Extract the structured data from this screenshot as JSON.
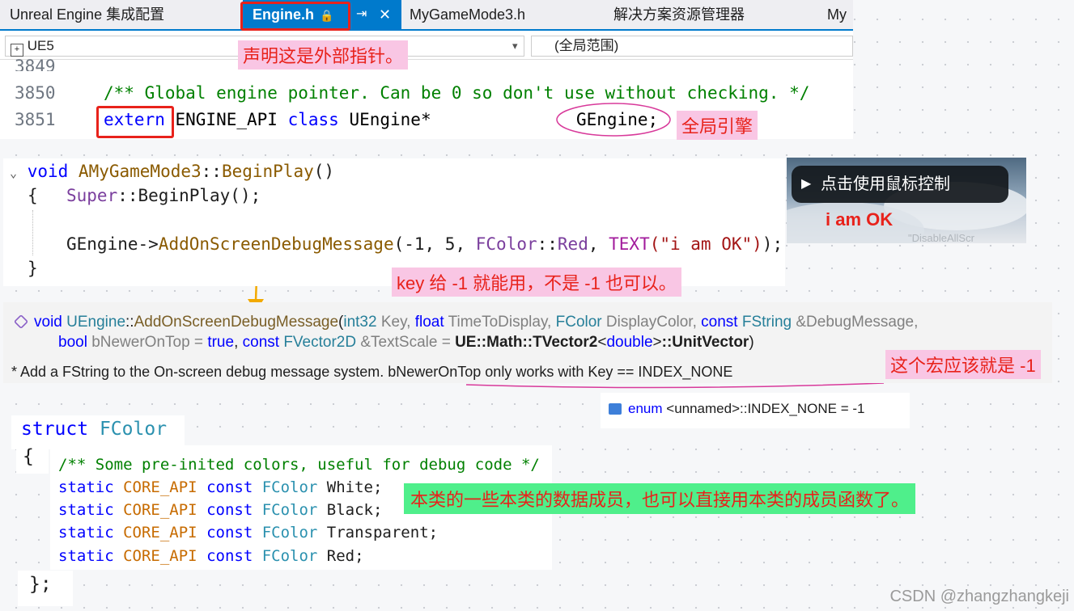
{
  "editor": {
    "tabs": [
      {
        "label": "Unreal Engine 集成配置"
      },
      {
        "label": "Engine.h",
        "lock": "🔒",
        "pin": "⇥",
        "close": "✕"
      },
      {
        "label": "MyGameMode3.h"
      },
      {
        "label": "解决方案资源管理器"
      },
      {
        "label": "My"
      }
    ],
    "nav": {
      "project": "UE5",
      "dropdown_arrow": "▾",
      "scope": "(全局范围)"
    },
    "line_numbers": [
      "3849",
      "3850",
      "3851"
    ],
    "code_comment": "/** Global engine pointer. Can be 0 so don't use without checking. */",
    "code_extern": "extern",
    "code_api": " ENGINE_API ",
    "code_class": "class",
    "code_type": " UEngine*",
    "code_var": "GEngine;"
  },
  "annotations": {
    "extern_note": "声明这是外部指针。",
    "gengine_note": "全局引擎",
    "key_note": "key 给 -1 就能用，不是 -1 也可以。",
    "macro_note": "这个宏应该就是 -1",
    "fcolor_note": "本类的一些本类的数据成员，也可以直接用本类的成员函数了。",
    "colors": {
      "red": "#e8221b",
      "pink_bg": "#f9c6e4",
      "green_bg": "#4fef8b",
      "arrow": "#f2a900"
    }
  },
  "beginplay": {
    "collapse_icon": "⌄",
    "kw_void": "void",
    "class_name": "AMyGameMode3",
    "sep": "::",
    "method": "BeginPlay",
    "parens": "()",
    "open_brace": "{",
    "super_kw": "Super",
    "super_rest": "BeginPlay();",
    "gengine_arrow": "GEngine->",
    "call_method": "AddOnScreenDebugMessage",
    "args_start": "(-1, 5, ",
    "fcolor_type": "FColor",
    "red_member": "Red",
    "args_comma": ", ",
    "text_macro": "TEXT",
    "text_str": "(\"i am OK\")",
    "args_end": ");",
    "close_brace": "}"
  },
  "game": {
    "hint": "点击使用鼠标控制",
    "message": "i am OK",
    "overlay_text": "\"DisableAllScr"
  },
  "tooltip": {
    "sig_void": "void",
    "sig_class": "UEngine",
    "sig_sep": "::",
    "sig_method": "AddOnScreenDebugMessage",
    "sig_paren": "(",
    "p1_type": "int32",
    "p1_name": " Key, ",
    "p2_type": "float",
    "p2_name": " TimeToDisplay, ",
    "p3_type": "FColor",
    "p3_name": " DisplayColor, ",
    "p4_const": "const",
    "p4_type": " FString",
    "p4_name": " &DebugMessage,",
    "p5_type": "bool",
    "p5_name": " bNewerOnTop = ",
    "p5_val": "true",
    "p5_comma": ", ",
    "p6_const": "const",
    "p6_type": " FVector2D",
    "p6_name": " &TextScale = ",
    "p6_val": "UE::Math::TVector2",
    "p6_lt": "<",
    "p6_tmpl": "double",
    "p6_gt": ">",
    "p6_tail": "::UnitVector",
    "p6_close": ")",
    "desc": "* Add a FString to the On-screen debug message system. bNewerOnTop only works with Key == INDEX_NONE",
    "enum_kw": "enum",
    "enum_text": "<unnamed>::INDEX_NONE = -1"
  },
  "fcolor": {
    "kw_struct": "struct",
    "name": "FColor",
    "open_brace": "{",
    "comment": "/** Some pre-inited colors, useful for debug code */",
    "members": [
      {
        "static": "static",
        "api": "CORE_API",
        "const": "const",
        "type": "FColor",
        "name": " White;"
      },
      {
        "static": "static",
        "api": "CORE_API",
        "const": "const",
        "type": "FColor",
        "name": " Black;"
      },
      {
        "static": "static",
        "api": "CORE_API",
        "const": "const",
        "type": "FColor",
        "name": " Transparent;"
      },
      {
        "static": "static",
        "api": "CORE_API",
        "const": "const",
        "type": "FColor",
        "name": " Red;"
      }
    ],
    "close_brace": "};"
  },
  "watermark": "CSDN @zhangzhangkeji"
}
